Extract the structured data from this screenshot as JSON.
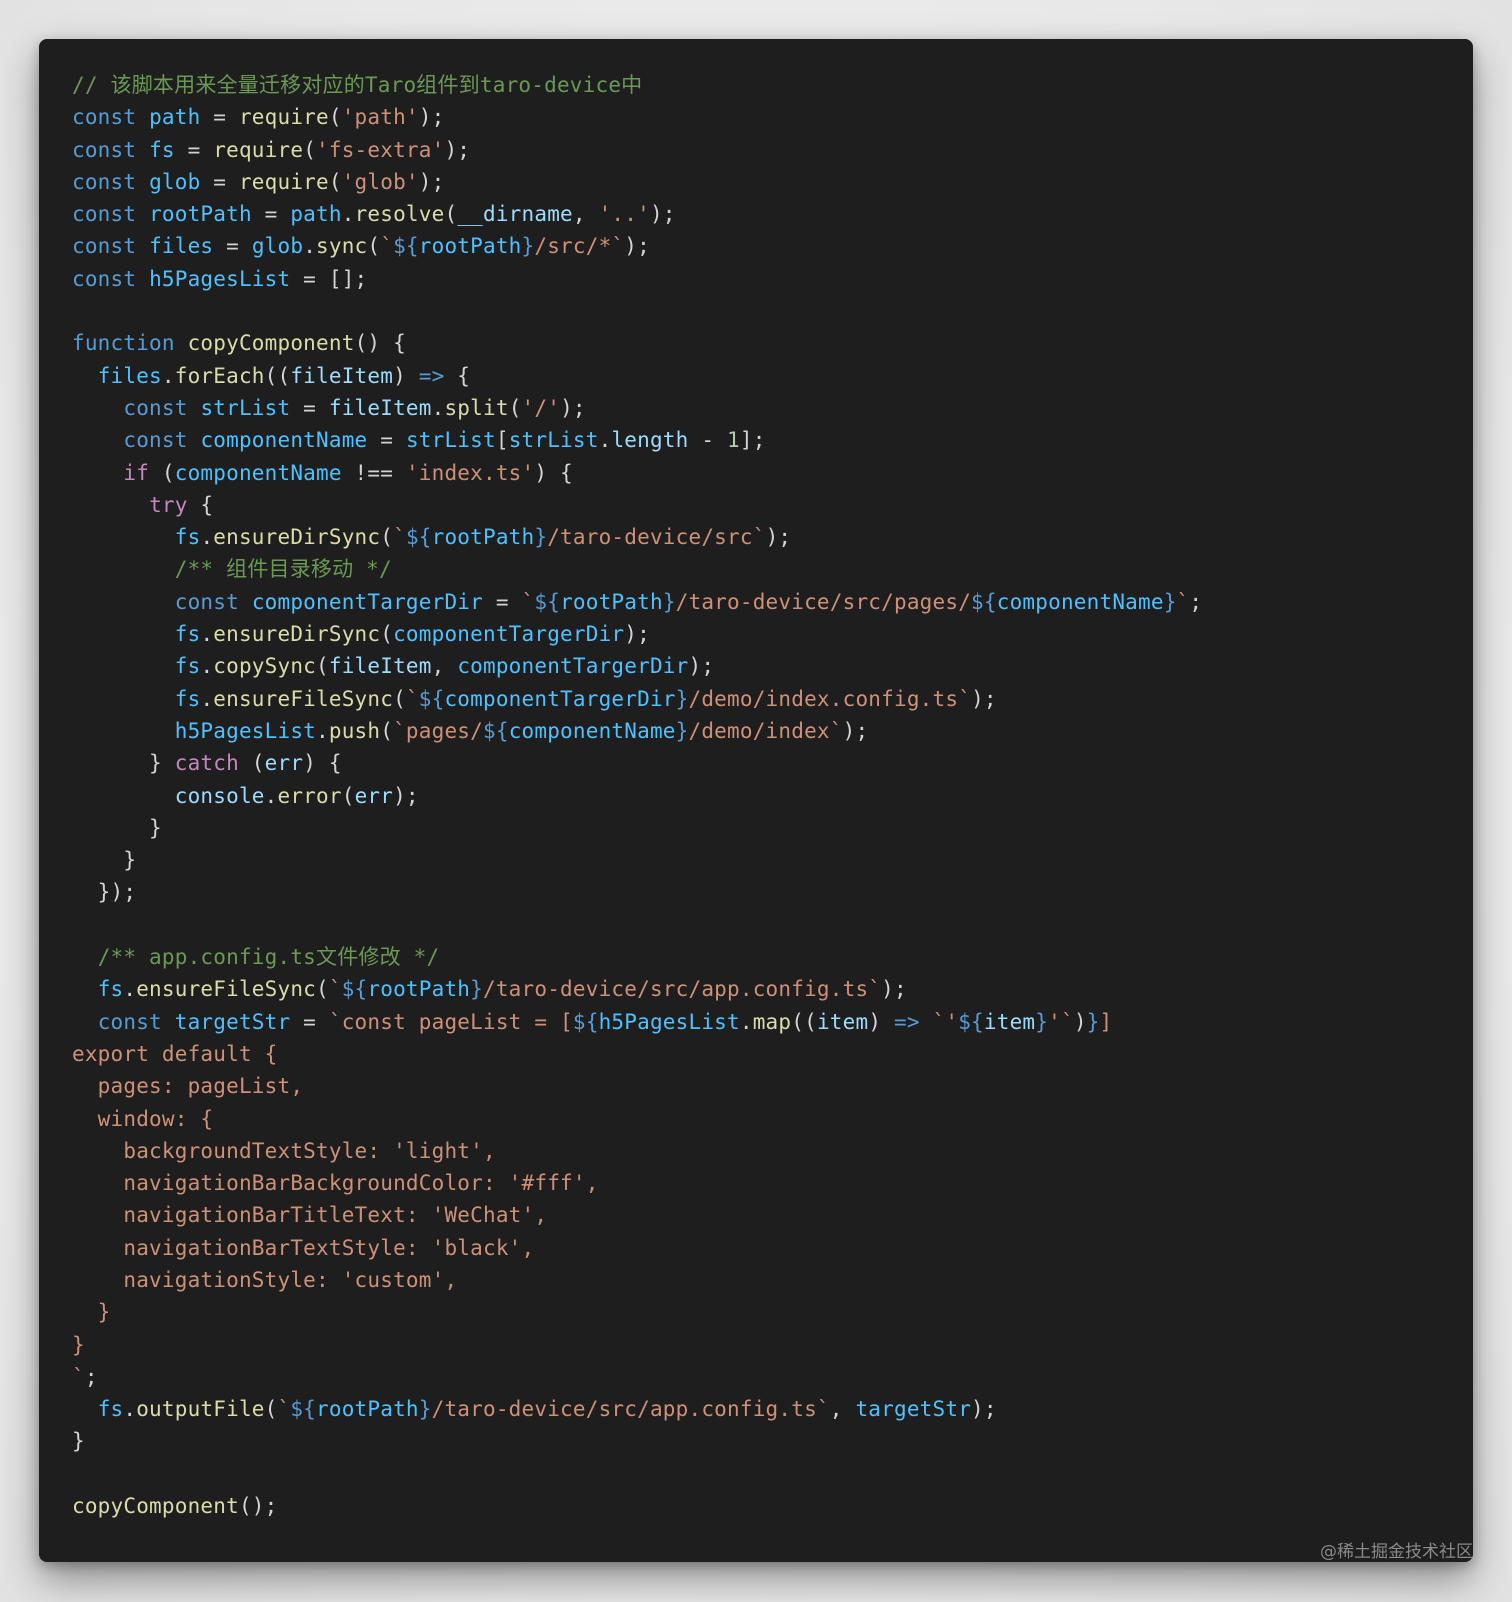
{
  "code_block": {
    "language": "javascript",
    "theme": {
      "background": "#1e1e1e",
      "comment": "#6a9955",
      "keyword": "#569cd6",
      "variable": "#4fc1ff",
      "parameter": "#9cdcfe",
      "function": "#dcdcaa",
      "string": "#ce9178",
      "control": "#c586c0",
      "number": "#b5cea8",
      "default": "#d4d4d4"
    },
    "lines": [
      [
        [
          "// 该脚本用来全量迁移对应的Taro组件到taro-device中",
          "c"
        ]
      ],
      [
        [
          "const",
          "k"
        ],
        [
          " ",
          "d"
        ],
        [
          "path",
          "v"
        ],
        [
          " = ",
          "d"
        ],
        [
          "require",
          "f"
        ],
        [
          "(",
          "d"
        ],
        [
          "'path'",
          "s"
        ],
        [
          ");",
          "d"
        ]
      ],
      [
        [
          "const",
          "k"
        ],
        [
          " ",
          "d"
        ],
        [
          "fs",
          "v"
        ],
        [
          " = ",
          "d"
        ],
        [
          "require",
          "f"
        ],
        [
          "(",
          "d"
        ],
        [
          "'fs-extra'",
          "s"
        ],
        [
          ");",
          "d"
        ]
      ],
      [
        [
          "const",
          "k"
        ],
        [
          " ",
          "d"
        ],
        [
          "glob",
          "v"
        ],
        [
          " = ",
          "d"
        ],
        [
          "require",
          "f"
        ],
        [
          "(",
          "d"
        ],
        [
          "'glob'",
          "s"
        ],
        [
          ");",
          "d"
        ]
      ],
      [
        [
          "const",
          "k"
        ],
        [
          " ",
          "d"
        ],
        [
          "rootPath",
          "v"
        ],
        [
          " = ",
          "d"
        ],
        [
          "path",
          "v"
        ],
        [
          ".",
          "d"
        ],
        [
          "resolve",
          "f"
        ],
        [
          "(",
          "d"
        ],
        [
          "__dirname",
          "p"
        ],
        [
          ", ",
          "d"
        ],
        [
          "'..'",
          "s"
        ],
        [
          ");",
          "d"
        ]
      ],
      [
        [
          "const",
          "k"
        ],
        [
          " ",
          "d"
        ],
        [
          "files",
          "v"
        ],
        [
          " = ",
          "d"
        ],
        [
          "glob",
          "v"
        ],
        [
          ".",
          "d"
        ],
        [
          "sync",
          "f"
        ],
        [
          "(",
          "d"
        ],
        [
          "`",
          "s"
        ],
        [
          "${",
          "t"
        ],
        [
          "rootPath",
          "v"
        ],
        [
          "}",
          "t"
        ],
        [
          "/src/*`",
          "s"
        ],
        [
          ");",
          "d"
        ]
      ],
      [
        [
          "const",
          "k"
        ],
        [
          " ",
          "d"
        ],
        [
          "h5PagesList",
          "v"
        ],
        [
          " = [];",
          "d"
        ]
      ],
      [],
      [
        [
          "function",
          "k"
        ],
        [
          " ",
          "d"
        ],
        [
          "copyComponent",
          "f"
        ],
        [
          "() {",
          "d"
        ]
      ],
      [
        [
          "  ",
          "d"
        ],
        [
          "files",
          "v"
        ],
        [
          ".",
          "d"
        ],
        [
          "forEach",
          "f"
        ],
        [
          "((",
          "d"
        ],
        [
          "fileItem",
          "p"
        ],
        [
          ") ",
          "d"
        ],
        [
          "=>",
          "k"
        ],
        [
          " {",
          "d"
        ]
      ],
      [
        [
          "    ",
          "d"
        ],
        [
          "const",
          "k"
        ],
        [
          " ",
          "d"
        ],
        [
          "strList",
          "v"
        ],
        [
          " = ",
          "d"
        ],
        [
          "fileItem",
          "p"
        ],
        [
          ".",
          "d"
        ],
        [
          "split",
          "f"
        ],
        [
          "(",
          "d"
        ],
        [
          "'/'",
          "s"
        ],
        [
          ");",
          "d"
        ]
      ],
      [
        [
          "    ",
          "d"
        ],
        [
          "const",
          "k"
        ],
        [
          " ",
          "d"
        ],
        [
          "componentName",
          "v"
        ],
        [
          " = ",
          "d"
        ],
        [
          "strList",
          "v"
        ],
        [
          "[",
          "d"
        ],
        [
          "strList",
          "v"
        ],
        [
          ".",
          "d"
        ],
        [
          "length",
          "p"
        ],
        [
          " - ",
          "d"
        ],
        [
          "1",
          "n"
        ],
        [
          "];",
          "d"
        ]
      ],
      [
        [
          "    ",
          "d"
        ],
        [
          "if",
          "ctl"
        ],
        [
          " (",
          "d"
        ],
        [
          "componentName",
          "v"
        ],
        [
          " !== ",
          "d"
        ],
        [
          "'index.ts'",
          "s"
        ],
        [
          ") {",
          "d"
        ]
      ],
      [
        [
          "      ",
          "d"
        ],
        [
          "try",
          "ctl"
        ],
        [
          " {",
          "d"
        ]
      ],
      [
        [
          "        ",
          "d"
        ],
        [
          "fs",
          "v"
        ],
        [
          ".",
          "d"
        ],
        [
          "ensureDirSync",
          "f"
        ],
        [
          "(",
          "d"
        ],
        [
          "`",
          "s"
        ],
        [
          "${",
          "t"
        ],
        [
          "rootPath",
          "v"
        ],
        [
          "}",
          "t"
        ],
        [
          "/taro-device/src`",
          "s"
        ],
        [
          ");",
          "d"
        ]
      ],
      [
        [
          "        ",
          "d"
        ],
        [
          "/** 组件目录移动 */",
          "c"
        ]
      ],
      [
        [
          "        ",
          "d"
        ],
        [
          "const",
          "k"
        ],
        [
          " ",
          "d"
        ],
        [
          "componentTargerDir",
          "v"
        ],
        [
          " = ",
          "d"
        ],
        [
          "`",
          "s"
        ],
        [
          "${",
          "t"
        ],
        [
          "rootPath",
          "v"
        ],
        [
          "}",
          "t"
        ],
        [
          "/taro-device/src/pages/",
          "s"
        ],
        [
          "${",
          "t"
        ],
        [
          "componentName",
          "v"
        ],
        [
          "}",
          "t"
        ],
        [
          "`",
          "s"
        ],
        [
          ";",
          "d"
        ]
      ],
      [
        [
          "        ",
          "d"
        ],
        [
          "fs",
          "v"
        ],
        [
          ".",
          "d"
        ],
        [
          "ensureDirSync",
          "f"
        ],
        [
          "(",
          "d"
        ],
        [
          "componentTargerDir",
          "v"
        ],
        [
          ");",
          "d"
        ]
      ],
      [
        [
          "        ",
          "d"
        ],
        [
          "fs",
          "v"
        ],
        [
          ".",
          "d"
        ],
        [
          "copySync",
          "f"
        ],
        [
          "(",
          "d"
        ],
        [
          "fileItem",
          "p"
        ],
        [
          ", ",
          "d"
        ],
        [
          "componentTargerDir",
          "v"
        ],
        [
          ");",
          "d"
        ]
      ],
      [
        [
          "        ",
          "d"
        ],
        [
          "fs",
          "v"
        ],
        [
          ".",
          "d"
        ],
        [
          "ensureFileSync",
          "f"
        ],
        [
          "(",
          "d"
        ],
        [
          "`",
          "s"
        ],
        [
          "${",
          "t"
        ],
        [
          "componentTargerDir",
          "v"
        ],
        [
          "}",
          "t"
        ],
        [
          "/demo/index.config.ts`",
          "s"
        ],
        [
          ");",
          "d"
        ]
      ],
      [
        [
          "        ",
          "d"
        ],
        [
          "h5PagesList",
          "v"
        ],
        [
          ".",
          "d"
        ],
        [
          "push",
          "f"
        ],
        [
          "(",
          "d"
        ],
        [
          "`pages/",
          "s"
        ],
        [
          "${",
          "t"
        ],
        [
          "componentName",
          "v"
        ],
        [
          "}",
          "t"
        ],
        [
          "/demo/index`",
          "s"
        ],
        [
          ");",
          "d"
        ]
      ],
      [
        [
          "      } ",
          "d"
        ],
        [
          "catch",
          "ctl"
        ],
        [
          " (",
          "d"
        ],
        [
          "err",
          "p"
        ],
        [
          ") {",
          "d"
        ]
      ],
      [
        [
          "        ",
          "d"
        ],
        [
          "console",
          "p"
        ],
        [
          ".",
          "d"
        ],
        [
          "error",
          "f"
        ],
        [
          "(",
          "d"
        ],
        [
          "err",
          "p"
        ],
        [
          ");",
          "d"
        ]
      ],
      [
        [
          "      }",
          "d"
        ]
      ],
      [
        [
          "    }",
          "d"
        ]
      ],
      [
        [
          "  });",
          "d"
        ]
      ],
      [],
      [
        [
          "  ",
          "d"
        ],
        [
          "/** app.config.ts文件修改 */",
          "c"
        ]
      ],
      [
        [
          "  ",
          "d"
        ],
        [
          "fs",
          "v"
        ],
        [
          ".",
          "d"
        ],
        [
          "ensureFileSync",
          "f"
        ],
        [
          "(",
          "d"
        ],
        [
          "`",
          "s"
        ],
        [
          "${",
          "t"
        ],
        [
          "rootPath",
          "v"
        ],
        [
          "}",
          "t"
        ],
        [
          "/taro-device/src/app.config.ts`",
          "s"
        ],
        [
          ");",
          "d"
        ]
      ],
      [
        [
          "  ",
          "d"
        ],
        [
          "const",
          "k"
        ],
        [
          " ",
          "d"
        ],
        [
          "targetStr",
          "v"
        ],
        [
          " = ",
          "d"
        ],
        [
          "`const pageList = [",
          "s"
        ],
        [
          "${",
          "t"
        ],
        [
          "h5PagesList",
          "v"
        ],
        [
          ".",
          "d"
        ],
        [
          "map",
          "f"
        ],
        [
          "((",
          "d"
        ],
        [
          "item",
          "p"
        ],
        [
          ") ",
          "d"
        ],
        [
          "=>",
          "k"
        ],
        [
          " ",
          "d"
        ],
        [
          "`'",
          "s"
        ],
        [
          "${",
          "t"
        ],
        [
          "item",
          "p"
        ],
        [
          "}",
          "t"
        ],
        [
          "'`",
          "s"
        ],
        [
          ")",
          "d"
        ],
        [
          "}",
          "t"
        ],
        [
          "]",
          "s"
        ]
      ],
      [
        [
          "export default {",
          "s"
        ]
      ],
      [
        [
          "  pages: pageList,",
          "s"
        ]
      ],
      [
        [
          "  window: {",
          "s"
        ]
      ],
      [
        [
          "    backgroundTextStyle: 'light',",
          "s"
        ]
      ],
      [
        [
          "    navigationBarBackgroundColor: '#fff',",
          "s"
        ]
      ],
      [
        [
          "    navigationBarTitleText: 'WeChat',",
          "s"
        ]
      ],
      [
        [
          "    navigationBarTextStyle: 'black',",
          "s"
        ]
      ],
      [
        [
          "    navigationStyle: 'custom',",
          "s"
        ]
      ],
      [
        [
          "  }",
          "s"
        ]
      ],
      [
        [
          "}",
          "s"
        ]
      ],
      [
        [
          "`",
          "s"
        ],
        [
          ";",
          "d"
        ]
      ],
      [
        [
          "  ",
          "d"
        ],
        [
          "fs",
          "v"
        ],
        [
          ".",
          "d"
        ],
        [
          "outputFile",
          "f"
        ],
        [
          "(",
          "d"
        ],
        [
          "`",
          "s"
        ],
        [
          "${",
          "t"
        ],
        [
          "rootPath",
          "v"
        ],
        [
          "}",
          "t"
        ],
        [
          "/taro-device/src/app.config.ts`",
          "s"
        ],
        [
          ", ",
          "d"
        ],
        [
          "targetStr",
          "v"
        ],
        [
          ");",
          "d"
        ]
      ],
      [
        [
          "}",
          "d"
        ]
      ],
      [],
      [
        [
          "copyComponent",
          "f"
        ],
        [
          "();",
          "d"
        ]
      ]
    ]
  },
  "watermark": {
    "text": "@稀土掘金技术社区"
  }
}
